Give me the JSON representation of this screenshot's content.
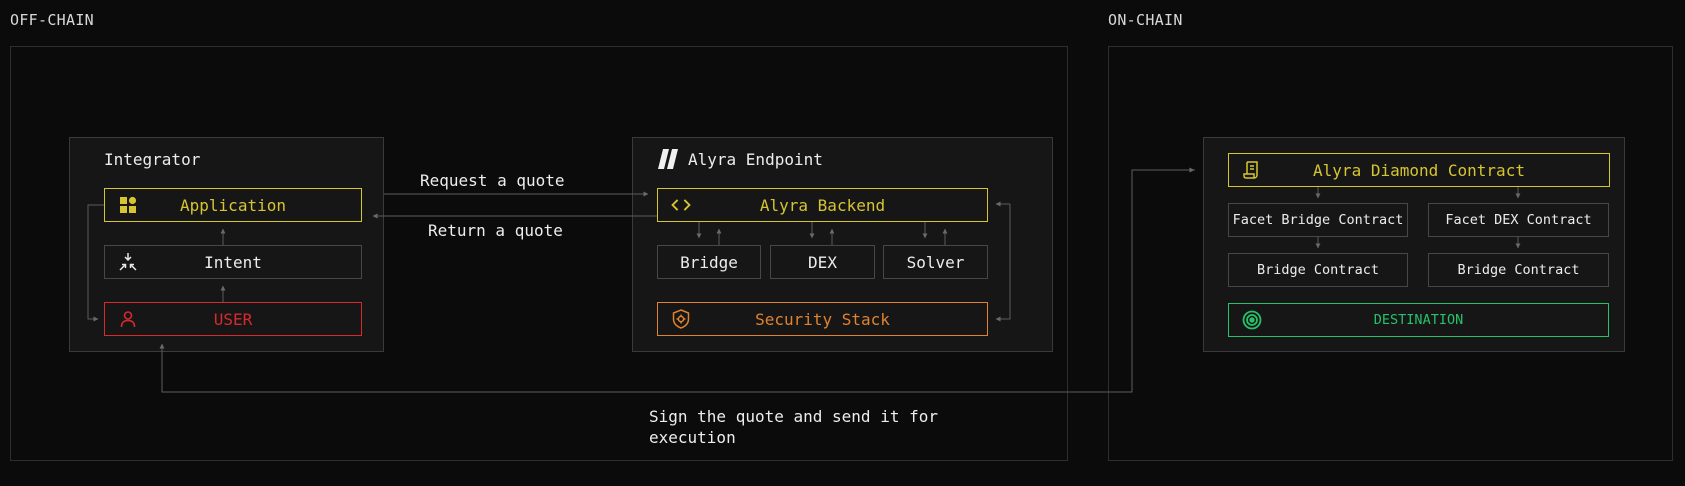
{
  "regions": {
    "offchain": "OFF-CHAIN",
    "onchain": "ON-CHAIN"
  },
  "integrator": {
    "title": "Integrator",
    "application": "Application",
    "intent": "Intent",
    "user": "USER"
  },
  "endpoint": {
    "title": "Alyra Endpoint",
    "backend": "Alyra Backend",
    "bridge": "Bridge",
    "dex": "DEX",
    "solver": "Solver",
    "security": "Security Stack"
  },
  "flows": {
    "request": "Request a quote",
    "return": "Return a quote",
    "sign_line1": "Sign the quote and send it for",
    "sign_line2": "execution"
  },
  "onchain": {
    "diamond": "Alyra Diamond Contract",
    "facet_bridge": "Facet Bridge Contract",
    "facet_dex": "Facet DEX Contract",
    "bridge_contract_1": "Bridge Contract",
    "bridge_contract_2": "Bridge Contract",
    "destination": "DESTINATION"
  },
  "colors": {
    "yellow": "#d6c531",
    "red": "#d8292e",
    "orange": "#e0822e",
    "green": "#25c26b",
    "line": "#6a6a6a"
  },
  "icons": {
    "application": "grid-icon",
    "intent": "collapse-arrows-icon",
    "user": "user-icon",
    "endpoint_logo": "alyra-logo-icon",
    "backend": "code-brackets-icon",
    "security": "shield-gear-icon",
    "diamond": "scroll-icon",
    "destination": "target-icon"
  }
}
